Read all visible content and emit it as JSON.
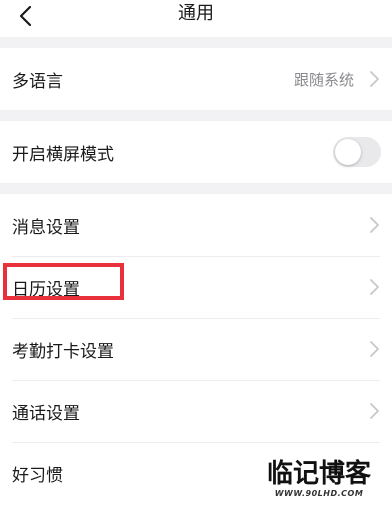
{
  "header": {
    "title": "通用",
    "back_icon": "chevron-left-icon"
  },
  "groups": [
    {
      "items": [
        {
          "label": "多语言",
          "value": "跟随系统",
          "accessory": "chevron"
        }
      ]
    },
    {
      "items": [
        {
          "label": "开启横屏模式",
          "accessory": "toggle",
          "toggle_on": false
        }
      ]
    },
    {
      "items": [
        {
          "label": "消息设置",
          "accessory": "chevron"
        },
        {
          "label": "日历设置",
          "accessory": "chevron",
          "highlighted": true
        },
        {
          "label": "考勤打卡设置",
          "accessory": "chevron"
        },
        {
          "label": "通话设置",
          "accessory": "chevron"
        },
        {
          "label": "好习惯",
          "accessory": "chevron"
        }
      ]
    }
  ],
  "watermark": {
    "main": "临记博客",
    "sub": "WWW.90LHD.COM"
  },
  "colors": {
    "background": "#f2f2f4",
    "card": "#ffffff",
    "highlight_border": "#e8313b",
    "secondary_text": "#8a8a8e",
    "chevron": "#c7c7cc",
    "toggle_off": "#e9e9eb"
  }
}
